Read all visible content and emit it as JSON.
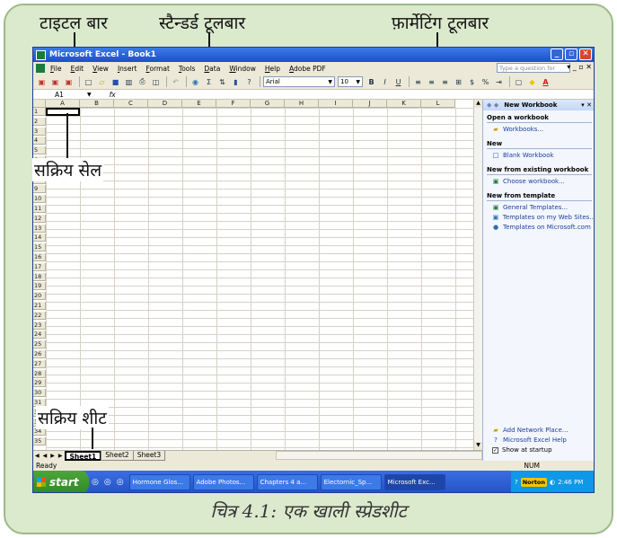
{
  "annotations": {
    "titlebar": "टाइटल बार",
    "standard_toolbar": "स्टैन्डर्ड टूलबार",
    "formatting_toolbar": "फ़ार्मेटिंग टूलबार",
    "active_cell": "सक्रिय सेल",
    "active_sheet": "सक्रिय शीट"
  },
  "caption": "चित्र 4.1: एक खाली स्प्रेडशीट",
  "window": {
    "title": "Microsoft Excel - Book1",
    "buttons": [
      "_",
      "▫",
      "✕"
    ]
  },
  "menu": {
    "items": [
      "File",
      "Edit",
      "View",
      "Insert",
      "Format",
      "Tools",
      "Data",
      "Window",
      "Help",
      "Adobe PDF"
    ],
    "help_placeholder": "Type a question for help",
    "controls": "▾ _ ▫ ✕"
  },
  "toolbar": {
    "font": "Arial",
    "size": "10",
    "bold": "B",
    "italic": "I",
    "underline": "U",
    "currency": "$",
    "percent": "%",
    "sum": "Σ",
    "font_color": "A"
  },
  "formula_bar": {
    "name_box": "A1",
    "fx": "fx"
  },
  "grid": {
    "columns": [
      "A",
      "B",
      "C",
      "D",
      "E",
      "F",
      "G",
      "H",
      "I",
      "J",
      "K",
      "L"
    ],
    "row_count": 35
  },
  "sheets": {
    "tabs": [
      "Sheet1",
      "Sheet2",
      "Sheet3"
    ],
    "active": "Sheet1"
  },
  "status": {
    "left": "Ready",
    "right": "NUM"
  },
  "task_pane": {
    "title": "New Workbook",
    "sections": [
      {
        "heading": "Open a workbook",
        "links": [
          "Workbooks..."
        ]
      },
      {
        "heading": "New",
        "links": [
          "Blank Workbook"
        ]
      },
      {
        "heading": "New from existing workbook",
        "links": [
          "Choose workbook..."
        ]
      },
      {
        "heading": "New from template",
        "links": [
          "General Templates...",
          "Templates on my Web Sites...",
          "Templates on Microsoft.com"
        ]
      }
    ],
    "bottom_links": [
      "Add Network Place...",
      "Microsoft Excel Help"
    ],
    "show_at_startup": "Show at startup"
  },
  "taskbar": {
    "start": "start",
    "tasks": [
      "Hormone Glos...",
      "Adobe Photos...",
      "Chapters 4 a...",
      "Electornic_Sp...",
      "Microsoft Exc..."
    ],
    "active_task": "Microsoft Exc...",
    "tray_norton": "Norton",
    "clock": "2:46 PM"
  }
}
